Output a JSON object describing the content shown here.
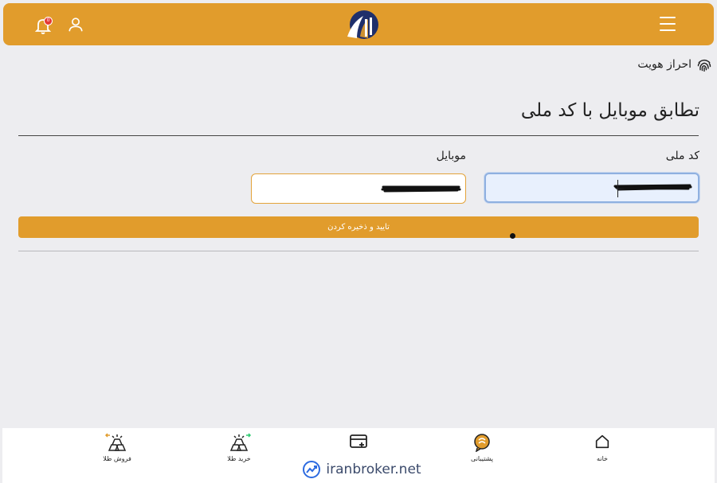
{
  "header": {
    "menu_icon": "hamburger-icon",
    "logo": "brand-logo",
    "user_icon": "user-icon",
    "bell_icon": "bell-icon",
    "notification_count": "0",
    "brand_color": "#e19c2c"
  },
  "breadcrumb": {
    "icon": "fingerprint-icon",
    "label": "احراز هویت"
  },
  "page": {
    "title": "تطابق موبایل با کد ملی"
  },
  "form": {
    "national_code_label": "کد ملی",
    "national_code_value": "",
    "mobile_label": "موبایل",
    "mobile_value": "",
    "confirm_label": "تایید و ذخیره کردن"
  },
  "bottom_nav": {
    "items": [
      {
        "label": "خانه",
        "icon": "home-icon"
      },
      {
        "label": "پشتیبانی",
        "icon": "support-chat-icon"
      },
      {
        "label": "",
        "icon": "wallet-add-icon"
      },
      {
        "label": "خرید طلا",
        "icon": "gold-bars-buy-icon"
      },
      {
        "label": "فروش طلا",
        "icon": "gold-bars-sell-icon"
      }
    ]
  },
  "watermark": {
    "text": "iranbroker.net",
    "icon": "trend-chart-icon"
  }
}
